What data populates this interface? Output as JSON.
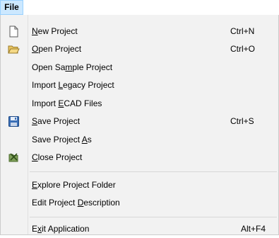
{
  "menubar": {
    "file_label": "File"
  },
  "menu": {
    "items": [
      {
        "label_pre": "",
        "label_u": "N",
        "label_post": "ew Project",
        "shortcut": "Ctrl+N",
        "icon": "new-file-icon"
      },
      {
        "label_pre": "",
        "label_u": "O",
        "label_post": "pen Project",
        "shortcut": "Ctrl+O",
        "icon": "open-folder-icon"
      },
      {
        "label_pre": "Open Sa",
        "label_u": "m",
        "label_post": "ple Project",
        "shortcut": "",
        "icon": ""
      },
      {
        "label_pre": "Import ",
        "label_u": "L",
        "label_post": "egacy Project",
        "shortcut": "",
        "icon": ""
      },
      {
        "label_pre": "Import ",
        "label_u": "E",
        "label_post": "CAD Files",
        "shortcut": "",
        "icon": ""
      },
      {
        "label_pre": "",
        "label_u": "S",
        "label_post": "ave Project",
        "shortcut": "Ctrl+S",
        "icon": "save-disk-icon"
      },
      {
        "label_pre": "Save Project ",
        "label_u": "A",
        "label_post": "s",
        "shortcut": "",
        "icon": ""
      },
      {
        "label_pre": "",
        "label_u": "C",
        "label_post": "lose Project",
        "shortcut": "",
        "icon": "close-project-icon"
      },
      {
        "label_pre": "",
        "label_u": "E",
        "label_post": "xplore Project Folder",
        "shortcut": "",
        "icon": ""
      },
      {
        "label_pre": "Edit Project ",
        "label_u": "D",
        "label_post": "escription",
        "shortcut": "",
        "icon": ""
      },
      {
        "label_pre": "E",
        "label_u": "x",
        "label_post": "it Application",
        "shortcut": "Alt+F4",
        "icon": ""
      }
    ]
  },
  "colors": {
    "menubar_highlight": "#cce8ff",
    "menu_background": "#f2f2f2",
    "separator": "#d7d7d7"
  }
}
